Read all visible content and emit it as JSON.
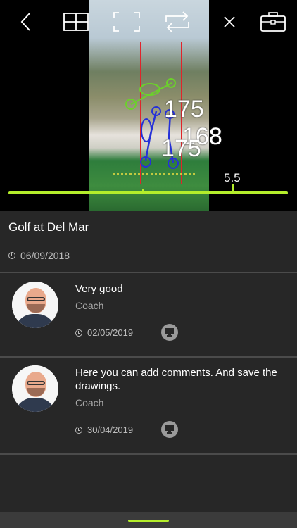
{
  "toolbar": {
    "back_icon": "chevron-left-icon",
    "grid_icon": "grid-icon",
    "fullscreen_icon": "fullscreen-corners-icon",
    "repeat_icon": "repeat-icon",
    "close_icon": "close-icon",
    "toolbox_icon": "briefcase-icon"
  },
  "video": {
    "angles": [
      "175",
      "168",
      "175"
    ],
    "scrub_value": "5.5"
  },
  "session": {
    "title": "Golf at Del Mar",
    "date": "06/09/2018"
  },
  "comments": [
    {
      "text": "Very good",
      "role": "Coach",
      "date": "02/05/2019",
      "screen_icon": "monitor-icon"
    },
    {
      "text": "Here you can add comments. And save the drawings.",
      "role": "Coach",
      "date": "30/04/2019",
      "screen_icon": "monitor-icon"
    }
  ],
  "colors": {
    "accent": "#b4ed2b",
    "background": "#272727",
    "divider": "#4b4b4b"
  }
}
